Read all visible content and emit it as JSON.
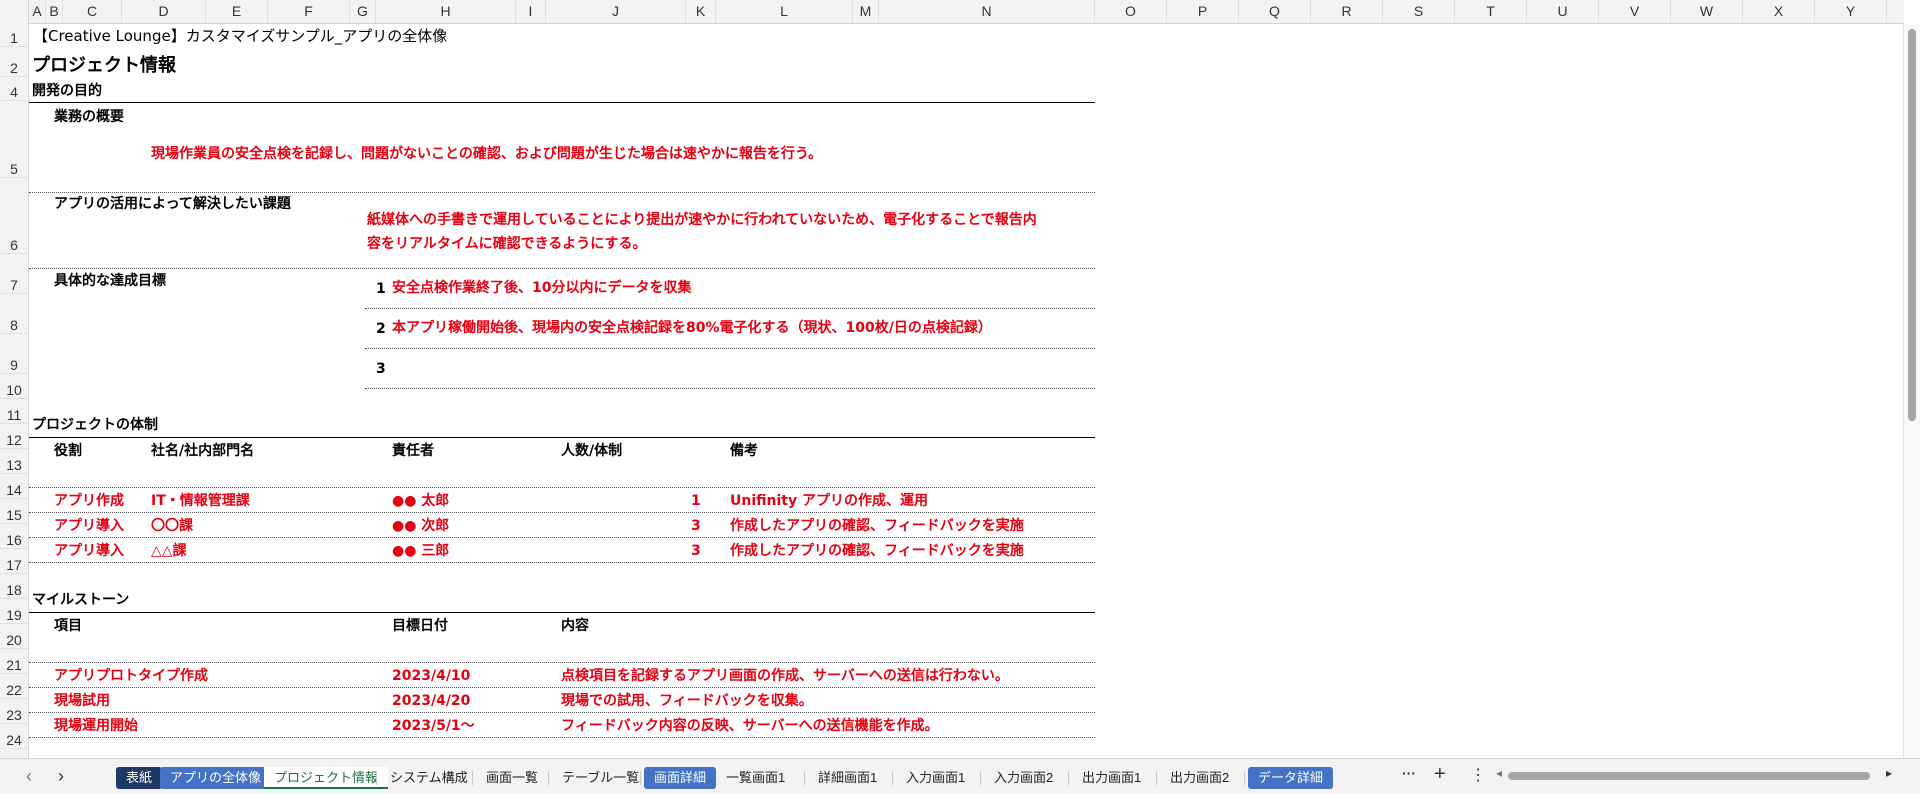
{
  "columns": [
    {
      "label": "A",
      "w": 17
    },
    {
      "label": "B",
      "w": 17
    },
    {
      "label": "C",
      "w": 59
    },
    {
      "label": "D",
      "w": 84
    },
    {
      "label": "E",
      "w": 62
    },
    {
      "label": "F",
      "w": 82
    },
    {
      "label": "G",
      "w": 26
    },
    {
      "label": "H",
      "w": 140
    },
    {
      "label": "I",
      "w": 30
    },
    {
      "label": "J",
      "w": 140
    },
    {
      "label": "K",
      "w": 30
    },
    {
      "label": "L",
      "w": 137
    },
    {
      "label": "M",
      "w": 26
    },
    {
      "label": "N",
      "w": 216
    },
    {
      "label": "O",
      "w": 72
    },
    {
      "label": "P",
      "w": 72
    },
    {
      "label": "Q",
      "w": 72
    },
    {
      "label": "R",
      "w": 72
    },
    {
      "label": "S",
      "w": 72
    },
    {
      "label": "T",
      "w": 72
    },
    {
      "label": "U",
      "w": 72
    },
    {
      "label": "V",
      "w": 72
    },
    {
      "label": "W",
      "w": 72
    },
    {
      "label": "X",
      "w": 72
    },
    {
      "label": "Y",
      "w": 72
    }
  ],
  "rows": [
    {
      "label": "1",
      "h": 24
    },
    {
      "label": "2",
      "h": 30
    },
    {
      "label": "4",
      "h": 24
    },
    {
      "label": "5",
      "h": 77
    },
    {
      "label": "6",
      "h": 76
    },
    {
      "label": "7",
      "h": 40
    },
    {
      "label": "8",
      "h": 40
    },
    {
      "label": "9",
      "h": 40
    },
    {
      "label": "10",
      "h": 25
    },
    {
      "label": "11",
      "h": 25
    },
    {
      "label": "12",
      "h": 25
    },
    {
      "label": "13",
      "h": 25
    },
    {
      "label": "14",
      "h": 25
    },
    {
      "label": "15",
      "h": 25
    },
    {
      "label": "16",
      "h": 25
    },
    {
      "label": "17",
      "h": 25
    },
    {
      "label": "18",
      "h": 25
    },
    {
      "label": "19",
      "h": 25
    },
    {
      "label": "20",
      "h": 25
    },
    {
      "label": "21",
      "h": 25
    },
    {
      "label": "22",
      "h": 25
    },
    {
      "label": "23",
      "h": 25
    },
    {
      "label": "24",
      "h": 25
    }
  ],
  "sheet": {
    "title": "【Creative Lounge】カスタマイズサンプル_アプリの全体像",
    "heading": "プロジェクト情報",
    "purpose": {
      "section": "開発の目的",
      "overview_label": "業務の概要",
      "overview_text": "現場作業員の安全点検を記録し、問題がないことの確認、および問題が生じた場合は速やかに報告を行う。",
      "issue_label": "アプリの活用によって解決したい課題",
      "issue_line1": "紙媒体への手書きで運用していることにより提出が速やかに行われていないため、電子化することで報告内",
      "issue_line2": "容をリアルタイムに確認できるようにする。",
      "goals_label": "具体的な達成目標",
      "goals": [
        {
          "num": "1",
          "text": "安全点検作業終了後、10分以内にデータを収集"
        },
        {
          "num": "2",
          "text": "本アプリ稼働開始後、現場内の安全点検記録を80%電子化する（現状、100枚/日の点検記録）"
        },
        {
          "num": "3",
          "text": ""
        }
      ]
    },
    "team": {
      "section": "プロジェクトの体制",
      "headers": {
        "role": "役割",
        "org": "社名/社内部門名",
        "owner": "責任者",
        "count": "人数/体制",
        "note": "備考"
      },
      "rows": [
        {
          "role": "アプリ作成",
          "org": "IT・情報管理課",
          "owner": "●● 太郎",
          "count": "1",
          "note": "Unifinity アプリの作成、運用"
        },
        {
          "role": "アプリ導入",
          "org": "〇〇課",
          "owner": "●● 次郎",
          "count": "3",
          "note": "作成したアプリの確認、フィードバックを実施"
        },
        {
          "role": "アプリ導入",
          "org": "△△課",
          "owner": "●● 三郎",
          "count": "3",
          "note": "作成したアプリの確認、フィードバックを実施"
        }
      ]
    },
    "milestones": {
      "section": "マイルストーン",
      "headers": {
        "item": "項目",
        "date": "目標日付",
        "content": "内容"
      },
      "rows": [
        {
          "item": "アプリプロトタイプ作成",
          "date": "2023/4/10",
          "content": "点検項目を記録するアプリ画面の作成、サーバーへの送信は行わない。"
        },
        {
          "item": "現場試用",
          "date": "2023/4/20",
          "content": "現場での試用、フィードバックを収集。"
        },
        {
          "item": "現場運用開始",
          "date": "2023/5/1～",
          "content": "フィードバック内容の反映、サーバーへの送信機能を作成。"
        }
      ]
    }
  },
  "tabs": [
    {
      "label": "表紙",
      "style": "dark"
    },
    {
      "label": "アプリの全体像",
      "style": "blue"
    },
    {
      "label": "プロジェクト情報",
      "style": "active"
    },
    {
      "label": "システム構成",
      "style": "plain"
    },
    {
      "label": "画面一覧",
      "style": "plain"
    },
    {
      "label": "テーブル一覧",
      "style": "plain"
    },
    {
      "label": "画面詳細",
      "style": "blue"
    },
    {
      "label": "一覧画面1",
      "style": "plain"
    },
    {
      "label": "詳細画面1",
      "style": "plain"
    },
    {
      "label": "入力画面1",
      "style": "plain"
    },
    {
      "label": "入力画面2",
      "style": "plain"
    },
    {
      "label": "出力画面1",
      "style": "plain"
    },
    {
      "label": "出力画面2",
      "style": "plain"
    },
    {
      "label": "データ詳細",
      "style": "blue"
    }
  ],
  "tabbar": {
    "prev": "‹",
    "next": "›",
    "more": "···",
    "add": "+",
    "menu": "⋮",
    "scroll_left": "◂",
    "scroll_right": "▸"
  },
  "colors": {
    "accent_red": "#e60012",
    "tab_dark": "#1f3864",
    "tab_blue": "#4472c4",
    "active_green": "#1e7145"
  }
}
